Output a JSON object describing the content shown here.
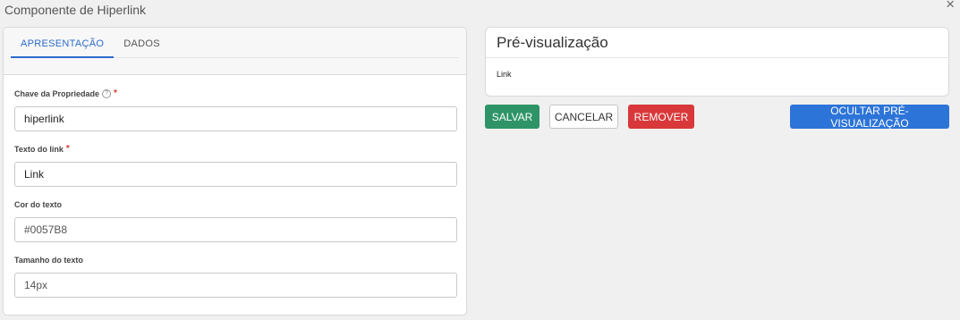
{
  "dialog": {
    "title": "Componente de Hiperlink",
    "close_glyph": "×"
  },
  "tabs": [
    {
      "label": "APRESENTAÇÃO",
      "active": true
    },
    {
      "label": "DADOS",
      "active": false
    }
  ],
  "fields": {
    "key": {
      "label": "Chave da Propriedade",
      "required_mark": "*",
      "help_glyph": "?",
      "value": "hiperlink"
    },
    "link_text": {
      "label": "Texto do link",
      "required_mark": "*",
      "value": "Link"
    },
    "text_color": {
      "label": "Cor do texto",
      "value": "#0057B8"
    },
    "text_size": {
      "label": "Tamanho do texto",
      "value": "14px"
    }
  },
  "preview": {
    "title": "Pré-visualização",
    "link_text": "Link"
  },
  "buttons": {
    "save": "SALVAR",
    "cancel": "CANCELAR",
    "remove": "REMOVER",
    "hide_preview": "OCULTAR PRÉ-VISUALIZAÇÃO"
  },
  "colors": {
    "primary": "#2d74d9",
    "tab_active": "#2d6bcc",
    "save": "#2e9467",
    "remove": "#d9383a",
    "required": "#d33333"
  },
  "icons": {
    "close": "close-icon",
    "help": "help-icon"
  }
}
